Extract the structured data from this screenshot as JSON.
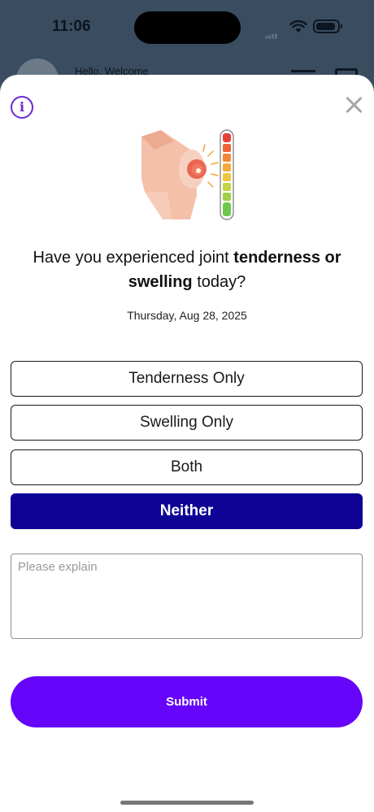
{
  "status_bar": {
    "time": "11:06"
  },
  "background": {
    "greeting": "Hello, Welcome"
  },
  "modal": {
    "question_prefix": "Have you experienced joint ",
    "question_bold": "tenderness or swelling",
    "question_suffix": " today?",
    "date": "Thursday, Aug 28, 2025",
    "options": [
      {
        "label": "Tenderness Only",
        "selected": false
      },
      {
        "label": "Swelling Only",
        "selected": false
      },
      {
        "label": "Both",
        "selected": false
      },
      {
        "label": "Neither",
        "selected": true
      }
    ],
    "explain_placeholder": "Please explain",
    "explain_value": "",
    "submit_label": "Submit"
  },
  "colors": {
    "accent_purple": "#6605f9",
    "selected_navy": "#0f0396",
    "info_purple": "#6b2bd6"
  },
  "icons": {
    "info": "info-icon",
    "close": "close-icon",
    "illustration": "knee-pain-illustration"
  }
}
